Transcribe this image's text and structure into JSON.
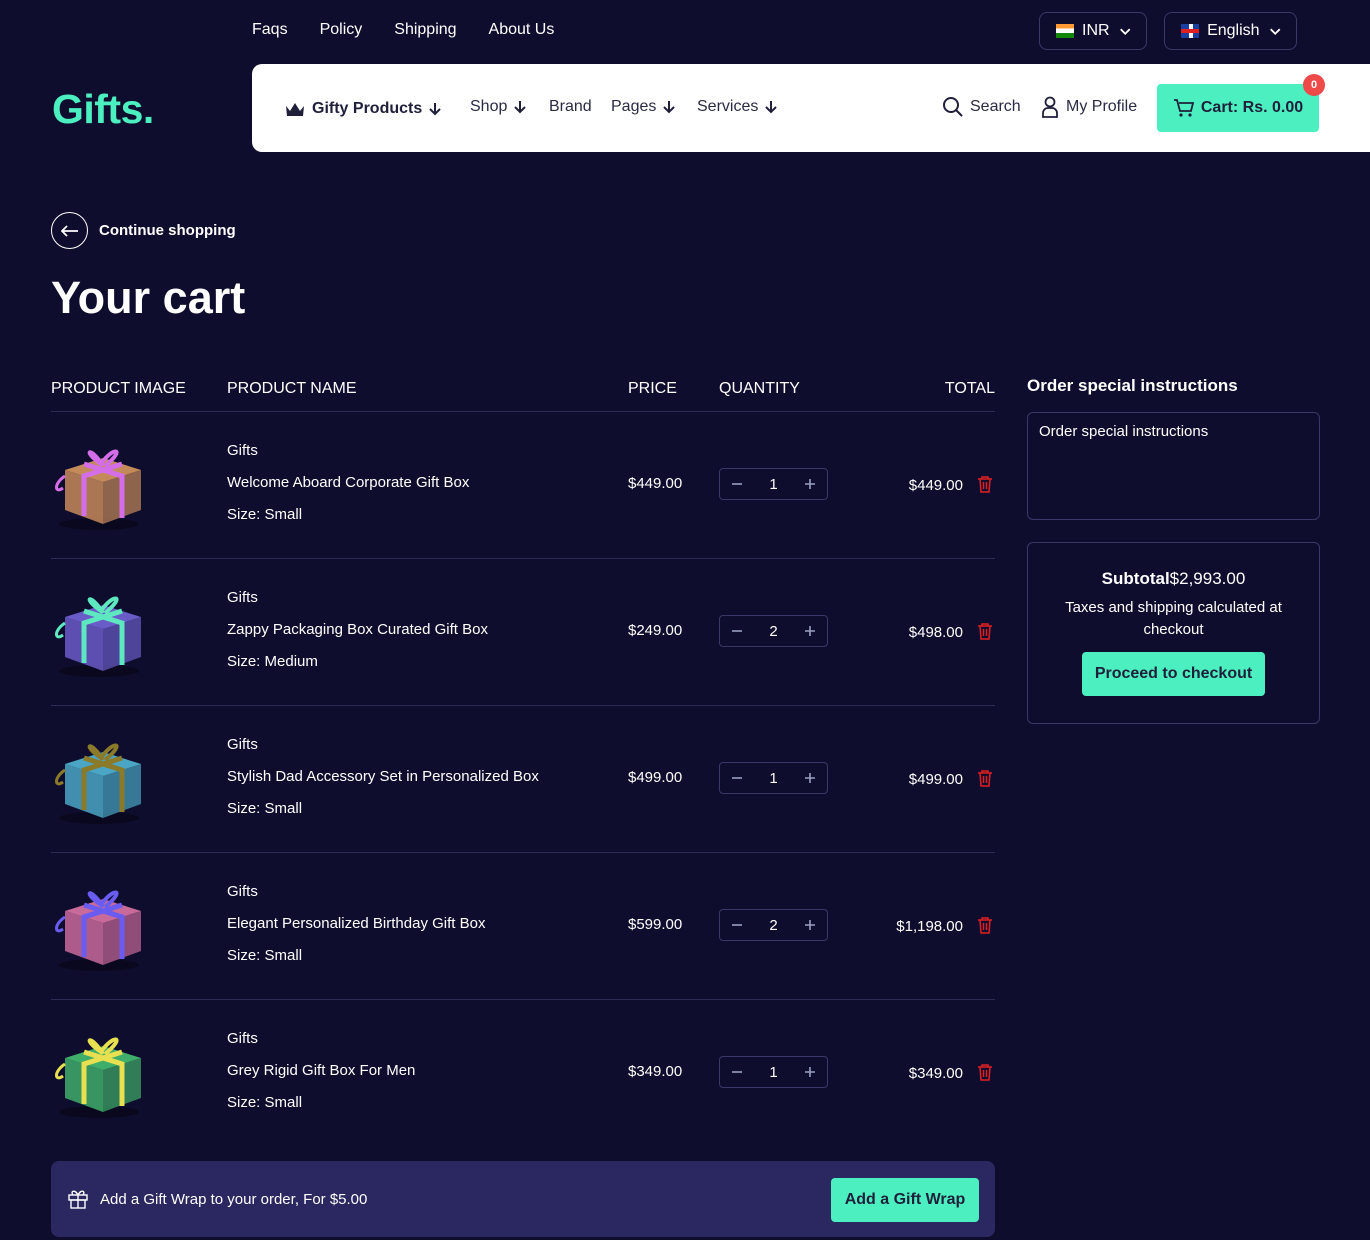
{
  "top_links": [
    "Faqs",
    "Policy",
    "Shipping",
    "About Us"
  ],
  "currency": {
    "flag_icon": "flag-india-icon",
    "label": "INR"
  },
  "language": {
    "flag_icon": "flag-uk-icon",
    "label": "English"
  },
  "logo": "Gifts.",
  "nav": {
    "gifty": "Gifty Products",
    "shop": "Shop",
    "brand": "Brand",
    "pages": "Pages",
    "services": "Services",
    "search": "Search",
    "profile": "My Profile",
    "cart": "Cart: Rs. 0.00",
    "cart_count": "0"
  },
  "continue_label": "Continue shopping",
  "page_title": "Your cart",
  "columns": {
    "image": "PRODUCT IMAGE",
    "name": "PRODUCT NAME",
    "price": "PRICE",
    "quantity": "QUANTITY",
    "total": "TOTAL"
  },
  "items": [
    {
      "vendor": "Gifts",
      "name": "Welcome Aboard Corporate Gift Box",
      "size_label": "Size:",
      "size": "Small",
      "price": "$449.00",
      "qty": "1",
      "total": "$449.00",
      "box_color": "#c58a5a",
      "ribbon_color": "#d46ee8"
    },
    {
      "vendor": "Gifts",
      "name": "Zappy Packaging Box Curated Gift Box",
      "size_label": "Size:",
      "size": "Medium",
      "price": "$249.00",
      "qty": "2",
      "total": "$498.00",
      "box_color": "#6a5cc8",
      "ribbon_color": "#5ee8c0"
    },
    {
      "vendor": "Gifts",
      "name": "Stylish Dad Accessory Set in Personalized Box",
      "size_label": "Size:",
      "size": "Small",
      "price": "$499.00",
      "qty": "1",
      "total": "$499.00",
      "box_color": "#4aa6c4",
      "ribbon_color": "#8a7a2a"
    },
    {
      "vendor": "Gifts",
      "name": "Elegant Personalized Birthday Gift Box",
      "size_label": "Size:",
      "size": "Small",
      "price": "$599.00",
      "qty": "2",
      "total": "$1,198.00",
      "box_color": "#c86a9a",
      "ribbon_color": "#6a5cf0"
    },
    {
      "vendor": "Gifts",
      "name": "Grey Rigid Gift Box For Men",
      "size_label": "Size:",
      "size": "Small",
      "price": "$349.00",
      "qty": "1",
      "total": "$349.00",
      "box_color": "#3fae6a",
      "ribbon_color": "#e8e050"
    }
  ],
  "gift_wrap": {
    "text": "Add a Gift Wrap to your order, For $5.00",
    "button": "Add a Gift Wrap"
  },
  "instructions": {
    "title": "Order special instructions",
    "placeholder": "Order special instructions"
  },
  "summary": {
    "subtotal_label": "Subtotal",
    "subtotal_value": "$2,993.00",
    "tax_note": "Taxes and shipping calculated at checkout",
    "checkout": "Proceed to checkout"
  },
  "colors": {
    "accent": "#4cf0c0",
    "background": "#0f0d2e",
    "badge": "#ef4a4a",
    "trash": "#e02020"
  }
}
